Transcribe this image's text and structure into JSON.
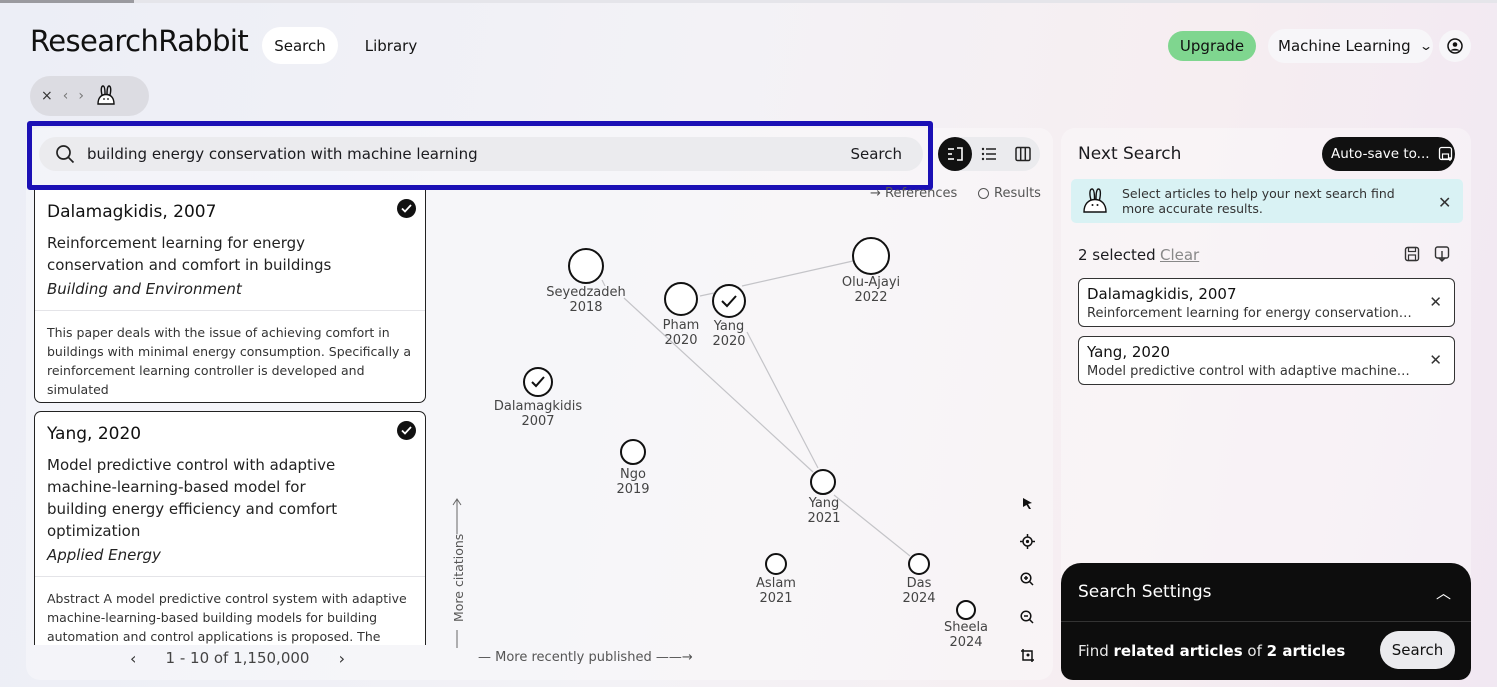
{
  "app": {
    "name": "ResearchRabbit",
    "nav": {
      "search_label": "Search",
      "library_label": "Library"
    },
    "upgrade_label": "Upgrade",
    "collection_label": "Machine Learning",
    "history": {
      "close": "×",
      "back": "‹",
      "forward": "›"
    }
  },
  "search": {
    "query": "building energy conservation with machine learning",
    "button_label": "Search"
  },
  "legend": {
    "references": "→ References",
    "results": "Results"
  },
  "articles": [
    {
      "author_year": "Dalamagkidis, 2007",
      "title": "Reinforcement learning for energy conservation and comfort in buildings",
      "journal": "Building and Environment",
      "abstract": "This paper deals with the issue of achieving comfort in buildings with minimal energy consumption. Specifically a reinforcement learning controller is developed and simulated",
      "selected": true
    },
    {
      "author_year": "Yang, 2020",
      "title": "Model predictive control with adaptive machine-learning-based model for building energy efficiency and comfort optimization",
      "journal": "Applied Energy",
      "abstract": "Abstract A model predictive control system with adaptive machine-learning-based building models for building automation and control applications is proposed. The system",
      "selected": true
    }
  ],
  "pager": {
    "prev": "‹",
    "range": "1 - 10 of 1,150,000",
    "next": "›"
  },
  "graph": {
    "nodes": [
      {
        "name": "Seyedzadeh",
        "year": "2018",
        "checked": false
      },
      {
        "name": "Pham",
        "year": "2020",
        "checked": false
      },
      {
        "name": "Yang",
        "year": "2020",
        "checked": true
      },
      {
        "name": "Olu-Ajayi",
        "year": "2022",
        "checked": false
      },
      {
        "name": "Dalamagkidis",
        "year": "2007",
        "checked": true
      },
      {
        "name": "Ngo",
        "year": "2019",
        "checked": false
      },
      {
        "name": "Yang",
        "year": "2021",
        "checked": false
      },
      {
        "name": "Aslam",
        "year": "2021",
        "checked": false
      },
      {
        "name": "Das",
        "year": "2024",
        "checked": false
      },
      {
        "name": "Sheela",
        "year": "2024",
        "checked": false
      }
    ],
    "y_axis_label": "More citations",
    "x_axis_label": "— More recently published ——→"
  },
  "next_search": {
    "title": "Next Search",
    "autosave_label": "Auto-save to...",
    "tip": "Select articles to help your next search find more accurate results.",
    "selected_count": "2 selected",
    "clear_label": "Clear",
    "selected": [
      {
        "author_year": "Dalamagkidis, 2007",
        "title": "Reinforcement learning for energy conservation and ..."
      },
      {
        "author_year": "Yang, 2020",
        "title": "Model predictive control with adaptive machine-lear..."
      }
    ]
  },
  "settings": {
    "title": "Search Settings",
    "find_prefix": "Find",
    "find_strong": "related articles",
    "find_mid": "of",
    "find_count": "2 articles",
    "button_label": "Search"
  }
}
